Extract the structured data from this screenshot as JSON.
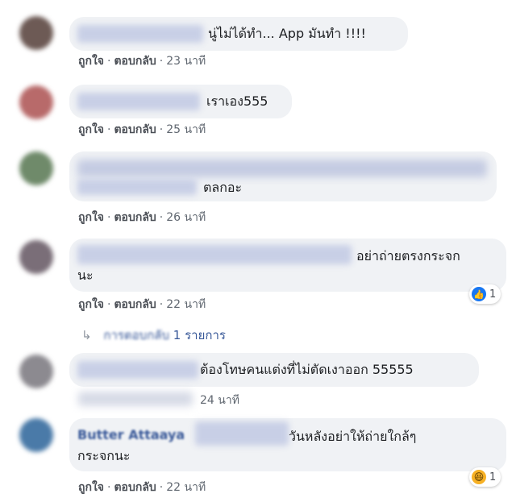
{
  "actions": {
    "like": "ถูกใจ",
    "reply": "ตอบกลับ",
    "separator": "·"
  },
  "comments": [
    {
      "text": "นู่ไม่ได้ทำ... App มันทำ !!!!",
      "time": "23 นาที"
    },
    {
      "text": "เราเอง555",
      "time": "25 นาที"
    },
    {
      "text": "ตลกอะ",
      "time": "26 นาที"
    },
    {
      "text_line1": "อย่าถ่ายตรงกระจก",
      "text_line2": "นะ",
      "time": "22 นาที",
      "reaction": {
        "icon": "like-icon",
        "count": "1"
      }
    },
    {
      "text": "ต้องโทษคนแต่งที่ไม่ตัดเงาออก 55555",
      "time": "24 นาที"
    },
    {
      "name": "Butter Attaaya",
      "text_line1": "วันหลังอย่าให้ถ่ายใกล้ๆ",
      "text_line2": "กระจกนะ",
      "time": "22 นาที",
      "reaction": {
        "icon": "haha-icon",
        "count": "1"
      }
    }
  ],
  "replies_link": {
    "blurred": "การตอบกลับ",
    "count_text": "1 รายการ"
  },
  "colors": {
    "bubble": "#f0f2f5",
    "link": "#385898",
    "like_blue": "#1877f2"
  }
}
